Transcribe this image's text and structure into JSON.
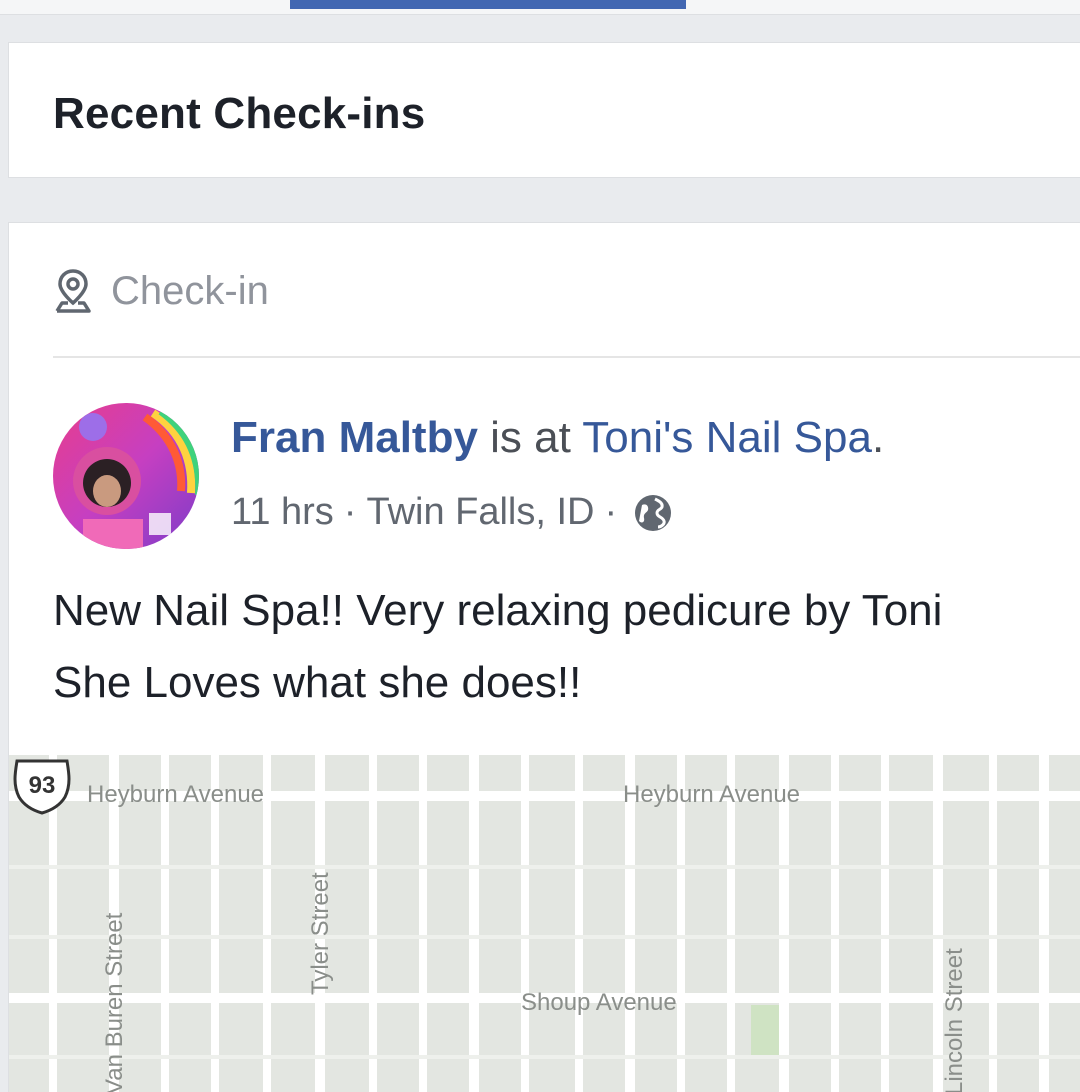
{
  "section": {
    "title": "Recent Check-ins"
  },
  "post": {
    "type_label": "Check-in",
    "author": "Fran Maltby",
    "action": " is at ",
    "place": "Toni's Nail Spa",
    "place_suffix": ".",
    "time": "11 hrs",
    "separator": "·",
    "location": "Twin Falls, ID",
    "body_line1": "New Nail Spa!! Very relaxing pedicure by Toni",
    "body_line2": "She Loves what she does!!"
  },
  "map": {
    "labels": {
      "heyburn_west": "Heyburn Avenue",
      "heyburn_east": "Heyburn Avenue",
      "shoup": "Shoup Avenue",
      "van_buren": "Van Buren Street",
      "tyler": "Tyler Street",
      "lincoln": "Lincoln Street",
      "route": "93"
    }
  },
  "colors": {
    "accent": "#4267b2",
    "link": "#365899",
    "map_bg": "#e3e6e1",
    "road": "#ffffff"
  },
  "icons": {
    "checkin": "map-pin-icon",
    "privacy": "globe-icon"
  }
}
